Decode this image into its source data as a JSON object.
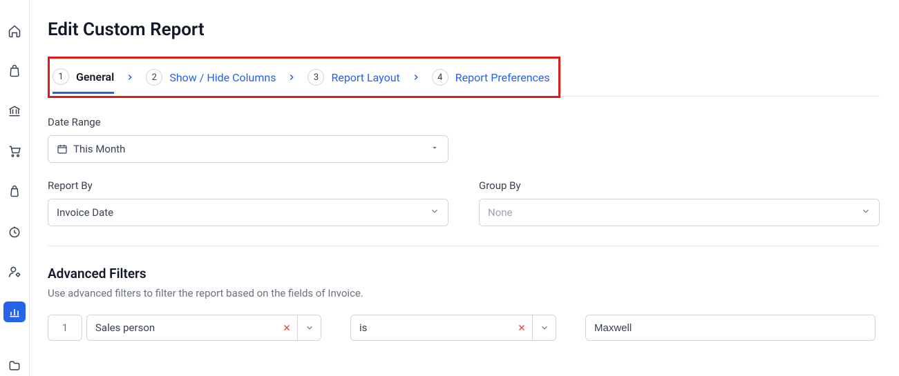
{
  "page_title": "Edit Custom Report",
  "steps": [
    {
      "num": "1",
      "label": "General"
    },
    {
      "num": "2",
      "label": "Show / Hide Columns"
    },
    {
      "num": "3",
      "label": "Report Layout"
    },
    {
      "num": "4",
      "label": "Report Preferences"
    }
  ],
  "date_range": {
    "label": "Date Range",
    "value": "This Month"
  },
  "report_by": {
    "label": "Report By",
    "value": "Invoice Date"
  },
  "group_by": {
    "label": "Group By",
    "value": "None"
  },
  "advanced": {
    "title": "Advanced Filters",
    "desc": "Use advanced filters to filter the report based on the fields of Invoice."
  },
  "filter1": {
    "num": "1",
    "field": "Sales person",
    "operator": "is",
    "value": "Maxwell"
  }
}
